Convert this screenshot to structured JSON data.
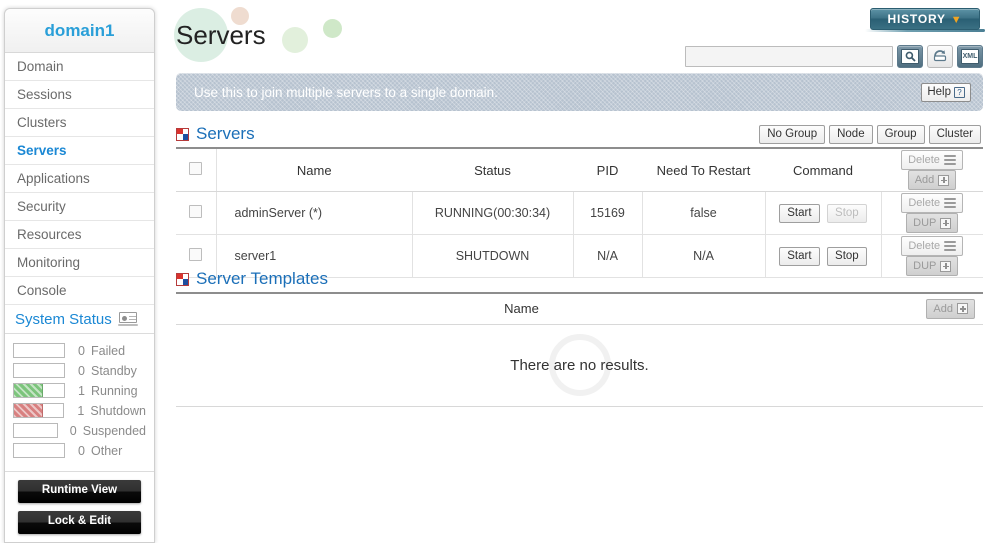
{
  "sidebar": {
    "domain_title": "domain1",
    "nav_items": [
      {
        "label": "Domain",
        "active": false
      },
      {
        "label": "Sessions",
        "active": false
      },
      {
        "label": "Clusters",
        "active": false
      },
      {
        "label": "Servers",
        "active": true
      },
      {
        "label": "Applications",
        "active": false
      },
      {
        "label": "Security",
        "active": false
      },
      {
        "label": "Resources",
        "active": false
      },
      {
        "label": "Monitoring",
        "active": false
      },
      {
        "label": "Console",
        "active": false
      }
    ],
    "system_status": {
      "title": "System Status",
      "icon": "laptop-icon",
      "rows": [
        {
          "count": "0",
          "label": "Failed",
          "fill": "none"
        },
        {
          "count": "0",
          "label": "Standby",
          "fill": "none"
        },
        {
          "count": "1",
          "label": "Running",
          "fill": "green"
        },
        {
          "count": "1",
          "label": "Shutdown",
          "fill": "red"
        },
        {
          "count": "0",
          "label": "Suspended",
          "fill": "none"
        },
        {
          "count": "0",
          "label": "Other",
          "fill": "none"
        }
      ]
    },
    "runtime_view_label": "Runtime View",
    "lock_edit_label": "Lock & Edit"
  },
  "header": {
    "page_title": "Servers",
    "history_label": "HISTORY",
    "history_chevron": "▼",
    "search_value": "",
    "search_placeholder": "",
    "tools": [
      {
        "name": "search-icon",
        "glyph": "🔍"
      },
      {
        "name": "refresh-icon",
        "glyph": "↻"
      },
      {
        "name": "xml-export-icon",
        "glyph": "XML"
      }
    ]
  },
  "banner": {
    "message": "Use this to join multiple servers to a single domain.",
    "help_label": "Help",
    "help_glyph": "?"
  },
  "servers_panel": {
    "title": "Servers",
    "filter_buttons": [
      "No Group",
      "Node",
      "Group",
      "Cluster"
    ],
    "columns": [
      "Name",
      "Status",
      "PID",
      "Need To Restart",
      "Command"
    ],
    "header_actions": {
      "delete_label": "Delete",
      "add_label": "Add"
    },
    "rows": [
      {
        "checked": false,
        "name": "adminServer (*)",
        "status": "RUNNING(00:30:34)",
        "pid": "15169",
        "need_to_restart": "false",
        "start_label": "Start",
        "stop_label": "Stop",
        "stop_enabled": false,
        "delete_label": "Delete",
        "dup_label": "DUP"
      },
      {
        "checked": false,
        "name": "server1",
        "status": "SHUTDOWN",
        "pid": "N/A",
        "need_to_restart": "N/A",
        "start_label": "Start",
        "stop_label": "Stop",
        "stop_enabled": true,
        "delete_label": "Delete",
        "dup_label": "DUP"
      }
    ]
  },
  "templates_panel": {
    "title": "Server Templates",
    "column_name": "Name",
    "add_label": "Add",
    "empty_message": "There are no results."
  },
  "colors": {
    "accent_blue": "#1b88d4",
    "panel_title": "#1b6fb8",
    "banner_bg": "#b6c2cf",
    "history_teal": "#3d7286",
    "history_chevron": "#f0a422",
    "running_green": "#7cc47c",
    "shutdown_red": "#d88080"
  }
}
